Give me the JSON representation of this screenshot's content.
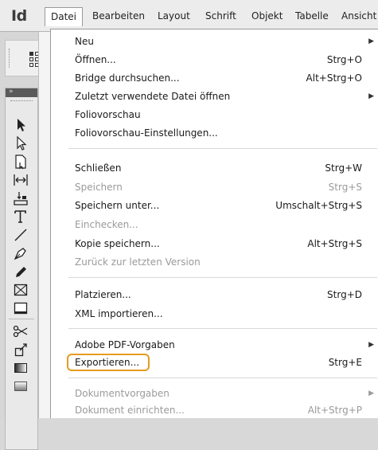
{
  "app": {
    "logo": "Id"
  },
  "menubar": {
    "items": [
      {
        "label": "Datei",
        "active": true
      },
      {
        "label": "Bearbeiten"
      },
      {
        "label": "Layout"
      },
      {
        "label": "Schrift"
      },
      {
        "label": "Objekt"
      },
      {
        "label": "Tabelle"
      },
      {
        "label": "Ansicht"
      }
    ]
  },
  "file_menu": {
    "items": [
      {
        "label": "Neu",
        "submenu": true
      },
      {
        "label": "Öffnen...",
        "shortcut": "Strg+O"
      },
      {
        "label": "Bridge durchsuchen...",
        "shortcut": "Alt+Strg+O"
      },
      {
        "label": "Zuletzt verwendete Datei öffnen",
        "submenu": true
      },
      {
        "label": "Foliovorschau"
      },
      {
        "label": "Foliovorschau-Einstellungen..."
      },
      {
        "label": "Schließen",
        "shortcut": "Strg+W"
      },
      {
        "label": "Speichern",
        "shortcut": "Strg+S",
        "disabled": true
      },
      {
        "label": "Speichern unter...",
        "shortcut": "Umschalt+Strg+S"
      },
      {
        "label": "Einchecken...",
        "disabled": true
      },
      {
        "label": "Kopie speichern...",
        "shortcut": "Alt+Strg+S"
      },
      {
        "label": "Zurück zur letzten Version",
        "disabled": true
      },
      {
        "label": "Platzieren...",
        "shortcut": "Strg+D"
      },
      {
        "label": "XML importieren..."
      },
      {
        "label": "Adobe PDF-Vorgaben",
        "submenu": true
      },
      {
        "label": "Exportieren...",
        "shortcut": "Strg+E",
        "highlighted": true
      },
      {
        "label": "Dokumentvorgaben",
        "submenu": true,
        "disabled": true
      },
      {
        "label": "Dokument einrichten...",
        "shortcut": "Alt+Strg+P",
        "disabled": true
      }
    ],
    "submenu_arrow": "▶"
  },
  "tools": [
    "selection-tool-icon",
    "direct-selection-tool-icon",
    "page-tool-icon",
    "gap-tool-icon",
    "content-collector-icon",
    "type-tool-icon",
    "line-tool-icon",
    "pen-tool-icon",
    "pencil-tool-icon",
    "rectangle-frame-tool-icon",
    "rectangle-tool-icon",
    "scissors-tool-icon",
    "free-transform-tool-icon",
    "gradient-swatch-tool-icon",
    "gradient-feather-tool-icon"
  ],
  "colors": {
    "highlight_ring": "#e69b20",
    "menu_bg": "#ffffff",
    "disabled_text": "#9a9a9a"
  }
}
